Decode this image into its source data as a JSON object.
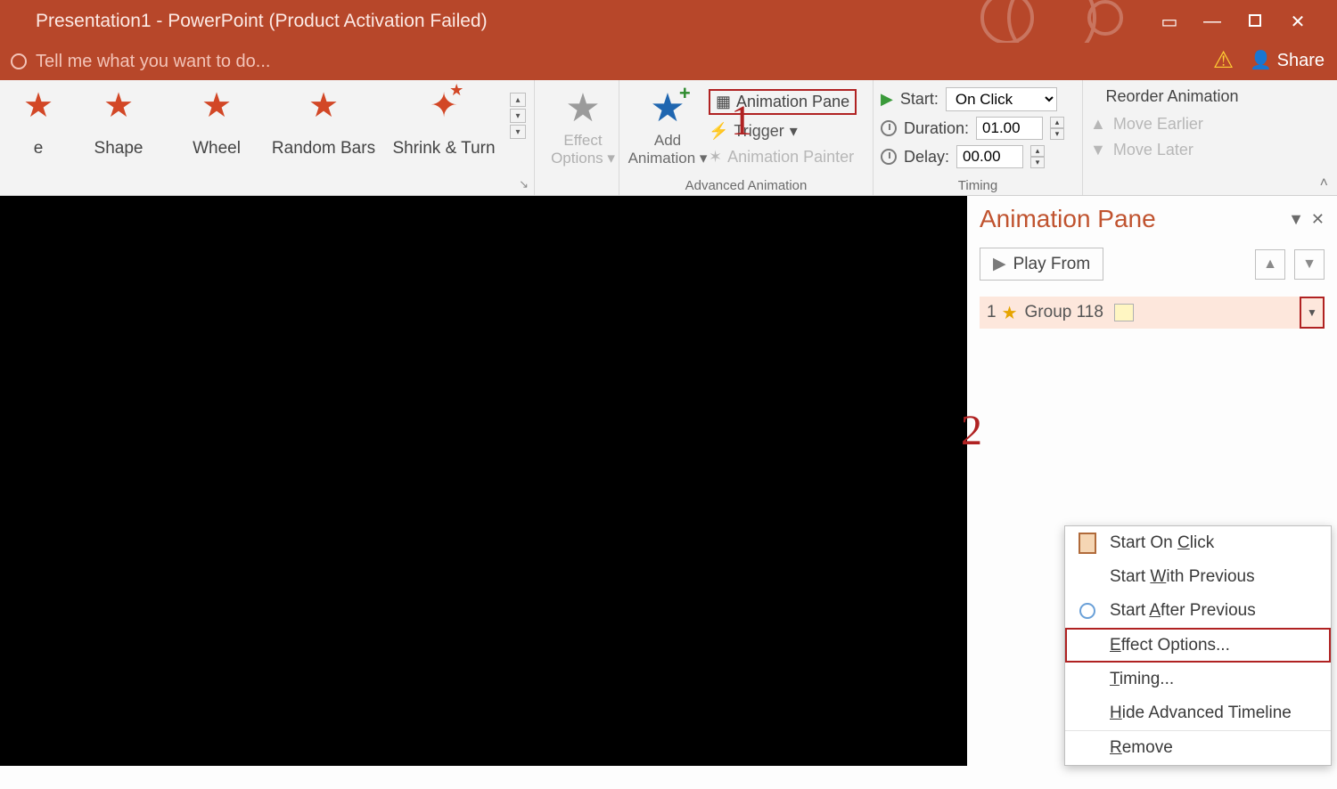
{
  "window": {
    "title": "Presentation1 - PowerPoint (Product Activation Failed)",
    "tellme_placeholder": "Tell me what you want to do...",
    "share_label": "Share"
  },
  "ribbon": {
    "gallery": [
      {
        "label": "e"
      },
      {
        "label": "Shape"
      },
      {
        "label": "Wheel"
      },
      {
        "label": "Random Bars"
      },
      {
        "label": "Shrink & Turn"
      }
    ],
    "effect_options": "Effect Options",
    "add_animation": "Add Animation",
    "animation_pane_btn": "Animation Pane",
    "trigger": "Trigger",
    "animation_painter": "Animation Painter",
    "group_advanced": "Advanced Animation",
    "timing": {
      "start_label": "Start:",
      "start_value": "On Click",
      "duration_label": "Duration:",
      "duration_value": "01.00",
      "delay_label": "Delay:",
      "delay_value": "00.00",
      "group_label": "Timing"
    },
    "reorder": {
      "header": "Reorder Animation",
      "earlier": "Move Earlier",
      "later": "Move Later"
    }
  },
  "pane": {
    "title": "Animation Pane",
    "play_from": "Play From",
    "item_index": "1",
    "item_name": "Group 118"
  },
  "context_menu": {
    "start_on_click": "Start On Click",
    "start_with_previous": "Start With Previous",
    "start_after_previous": "Start After Previous",
    "effect_options": "Effect Options...",
    "timing": "Timing...",
    "hide_timeline": "Hide Advanced Timeline",
    "remove": "Remove"
  },
  "annotations": {
    "one": "1",
    "two": "2"
  }
}
